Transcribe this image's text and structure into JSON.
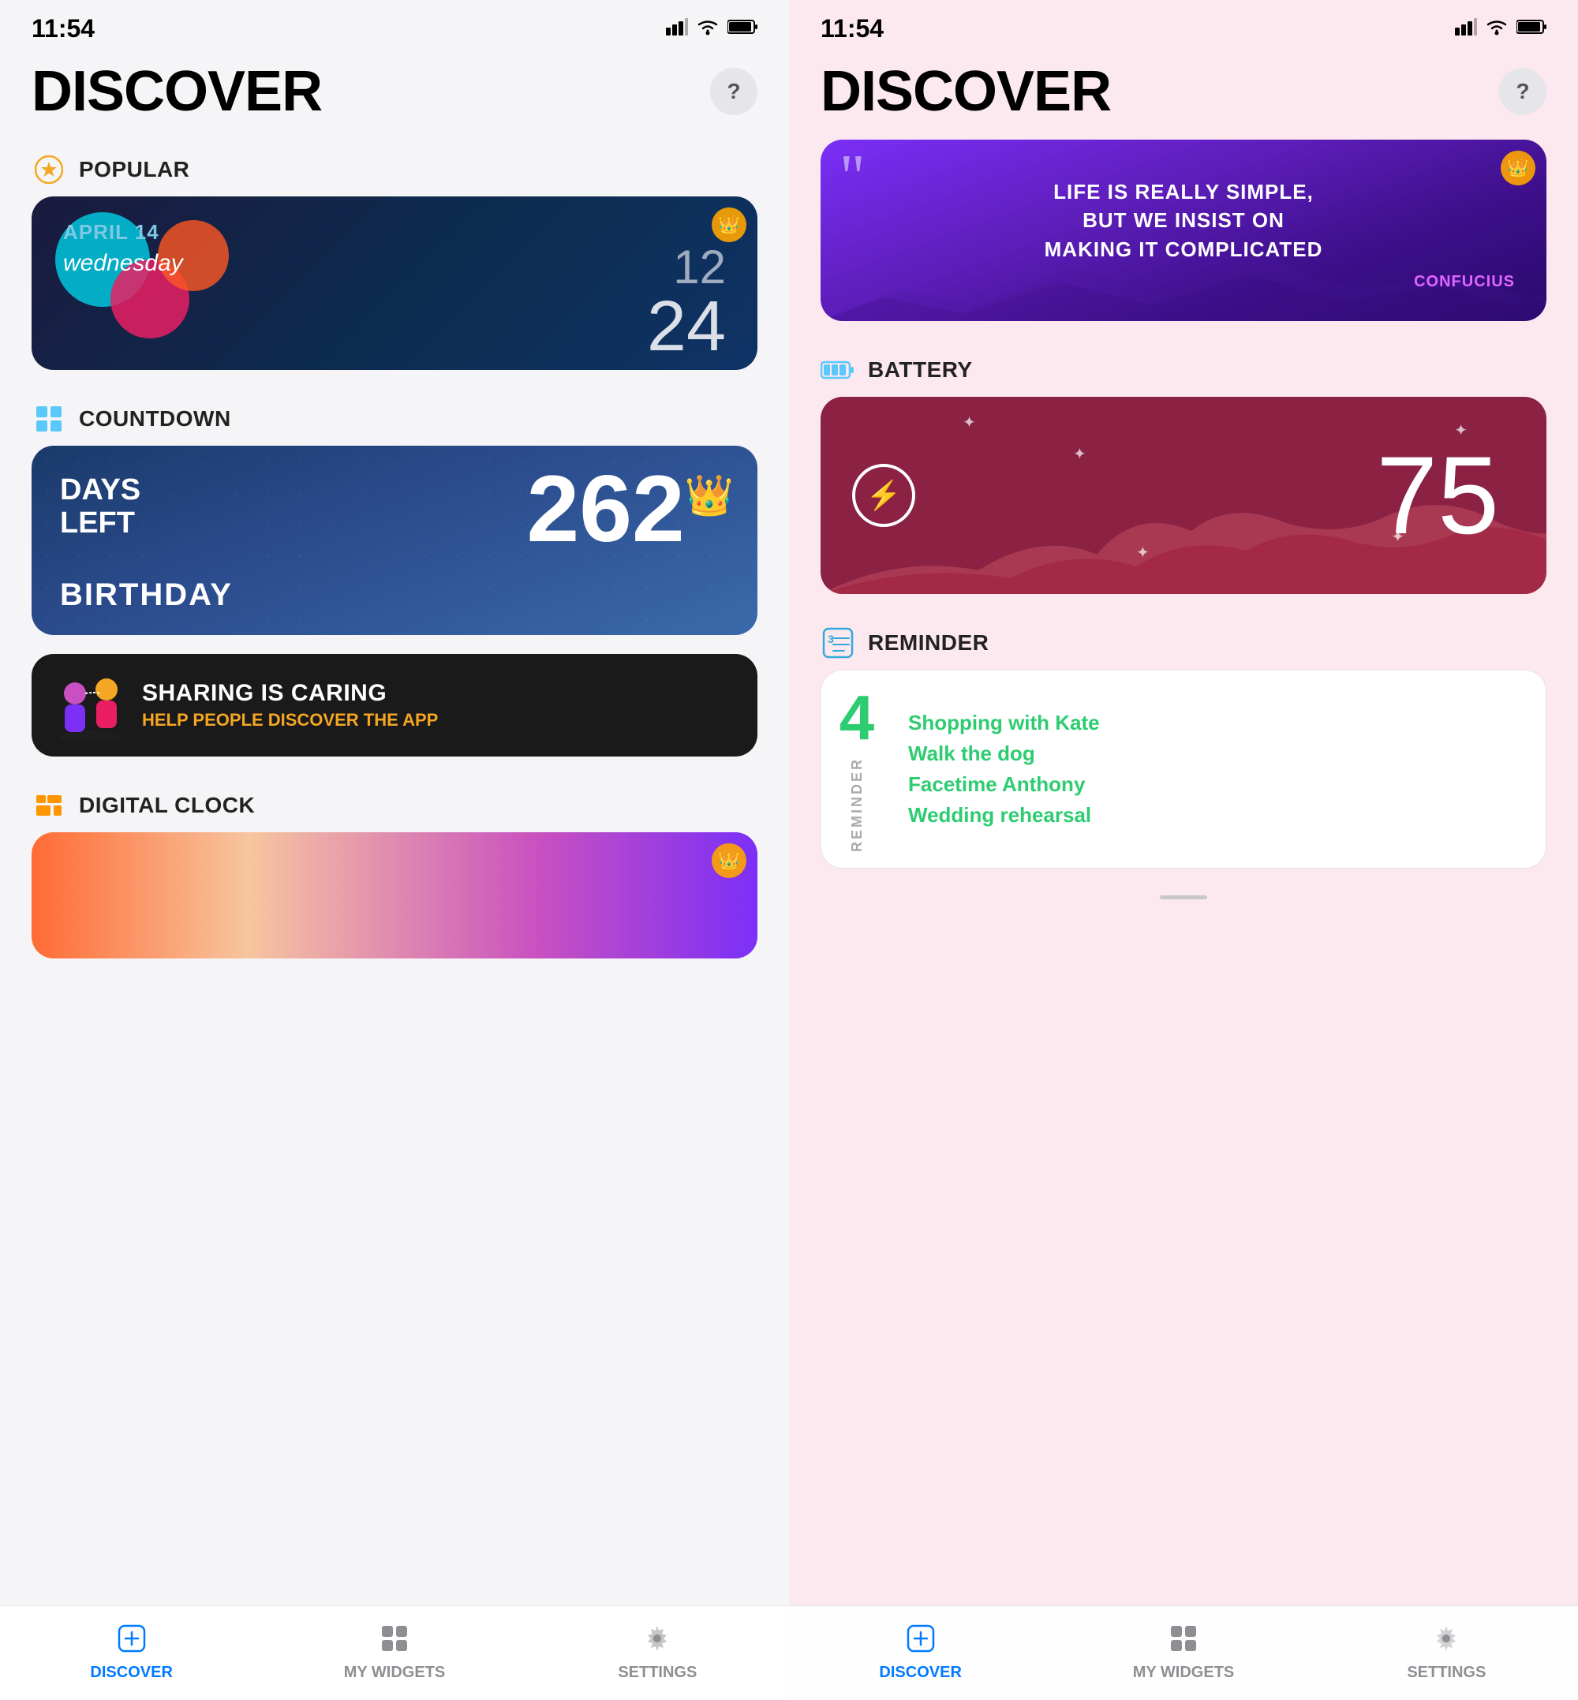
{
  "left_screen": {
    "status_bar": {
      "time": "11:54",
      "signal": "▐▌▌",
      "wifi": "wifi",
      "battery": "battery"
    },
    "header": {
      "title": "DISCOVER",
      "help_label": "?"
    },
    "sections": [
      {
        "id": "popular",
        "label": "POPULAR",
        "icon": "star-icon"
      },
      {
        "id": "countdown",
        "label": "COUNTDOWN",
        "icon": "grid-icon"
      },
      {
        "id": "digital_clock",
        "label": "DIGITAL CLOCK",
        "icon": "clock-icon"
      }
    ],
    "popular_card": {
      "date": "APRIL 14",
      "weekday": "wednesday",
      "time_hour": "12",
      "time_min": "24"
    },
    "countdown_card": {
      "days_left_line1": "DAYS",
      "days_left_line2": "LEFT",
      "number": "262",
      "event": "BIRTHDAY"
    },
    "sharing_card": {
      "title": "SHARING IS CARING",
      "subtitle": "HELP PEOPLE DISCOVER THE APP"
    },
    "nav": {
      "items": [
        {
          "id": "discover",
          "label": "DISCOVER",
          "icon": "plus-square-icon",
          "active": true
        },
        {
          "id": "my_widgets",
          "label": "MY WIDGETS",
          "icon": "widgets-icon",
          "active": false
        },
        {
          "id": "settings",
          "label": "SETTINGS",
          "icon": "gear-icon",
          "active": false
        }
      ]
    }
  },
  "right_screen": {
    "status_bar": {
      "time": "11:54",
      "signal": "▐▌▌",
      "wifi": "wifi",
      "battery": "battery"
    },
    "header": {
      "title": "DISCOVER",
      "help_label": "?"
    },
    "sections": [
      {
        "id": "battery",
        "label": "BATTERY",
        "icon": "battery-icon"
      },
      {
        "id": "reminder",
        "label": "REMINDER",
        "icon": "reminder-icon"
      }
    ],
    "quote_card": {
      "line1": "LIFE IS REALLY SIMPLE,",
      "line2": "BUT WE INSIST ON",
      "line3": "MAKING IT COMPLICATED",
      "author": "CONFUCIUS"
    },
    "battery_card": {
      "value": "75"
    },
    "reminder_card": {
      "count": "4",
      "label_vert": "REMINDER",
      "items": [
        "Shopping with Kate",
        "Walk the dog",
        "Facetime Anthony",
        "Wedding rehearsal"
      ]
    },
    "nav": {
      "items": [
        {
          "id": "discover",
          "label": "DISCOVER",
          "icon": "plus-square-icon",
          "active": true
        },
        {
          "id": "my_widgets",
          "label": "MY WIDGETS",
          "icon": "widgets-icon",
          "active": false
        },
        {
          "id": "settings",
          "label": "SETTINGS",
          "icon": "gear-icon",
          "active": false
        }
      ]
    }
  }
}
